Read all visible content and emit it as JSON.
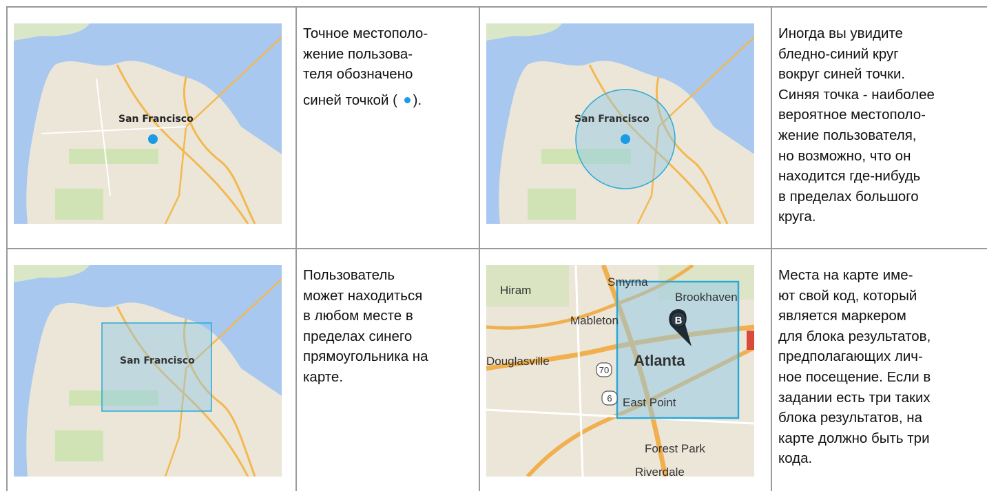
{
  "cells": [
    {
      "map_label": "San Francisco",
      "lines": [
        "Точное местополо-",
        "жение пользова-",
        "теля обозначено",
        "синей точкой ( ",
        ")."
      ]
    },
    {
      "map_label": "San Francisco",
      "lines": [
        "Иногда вы увидите",
        "бледно-синий круг",
        "вокруг синей точки.",
        "Синяя точка - наиболее",
        "вероятное местополо-",
        "жение пользователя,",
        "но возможно, что он",
        "находится где-нибудь",
        "в пределах большого",
        "круга."
      ]
    },
    {
      "map_label": "San Francisco",
      "lines": [
        "Пользователь",
        "может находиться",
        "в любом месте в",
        "пределах синего",
        "прямоугольника на",
        "карте."
      ]
    },
    {
      "map_places": [
        "Hiram",
        "Smyrna",
        "Brookhaven",
        "Mableton",
        "Douglasville",
        "Atlanta",
        "East Point",
        "Forest Park",
        "Riverdale"
      ],
      "route_numbers": [
        "70",
        "6"
      ],
      "marker_letter": "B",
      "lines": [
        "Места на карте име-",
        "ют свой код, который",
        "является маркером",
        "для блока результатов,",
        "предполагающих лич-",
        "ное посещение. Если в",
        "задании есть три таких",
        "блока результатов, на",
        "карте должно быть три",
        "кода."
      ]
    }
  ],
  "colors": {
    "location_dot": "#1a9be3",
    "accuracy_fill": "#8ec8e8",
    "accuracy_stroke": "#2aa8d8",
    "water": "#a9c8f0",
    "land": "#ece6d8"
  }
}
